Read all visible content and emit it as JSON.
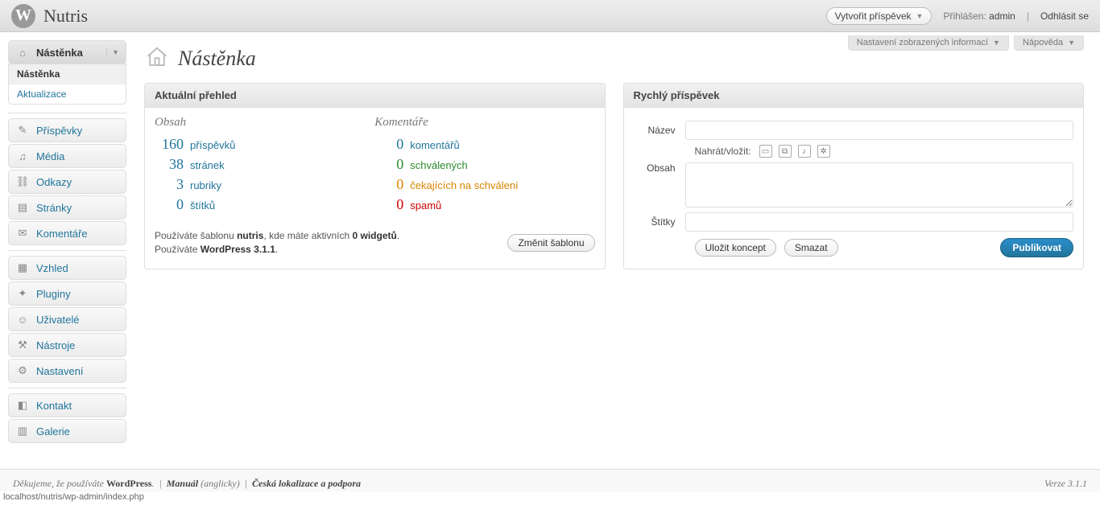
{
  "header": {
    "site_title": "Nutris",
    "logo_letter": "W",
    "new_post": "Vytvořit příspěvek",
    "howdy_prefix": "Přihlášen:",
    "user": "admin",
    "logout": "Odhlásit se"
  },
  "screen_meta": {
    "options": "Nastavení zobrazených informací",
    "help": "Nápověda"
  },
  "page_title": "Nástěnka",
  "sidebar": {
    "dashboard": {
      "label": "Nástěnka",
      "sub_dashboard": "Nástěnka",
      "sub_updates": "Aktualizace"
    },
    "posts": {
      "label": "Příspěvky"
    },
    "media": {
      "label": "Média"
    },
    "links": {
      "label": "Odkazy"
    },
    "pages": {
      "label": "Stránky"
    },
    "comments": {
      "label": "Komentáře"
    },
    "appearance": {
      "label": "Vzhled"
    },
    "plugins": {
      "label": "Pluginy"
    },
    "users": {
      "label": "Uživatelé"
    },
    "tools": {
      "label": "Nástroje"
    },
    "settings": {
      "label": "Nastavení"
    },
    "kontakt": {
      "label": "Kontakt"
    },
    "galerie": {
      "label": "Galerie"
    }
  },
  "right_now": {
    "title": "Aktuální přehled",
    "content_head": "Obsah",
    "discussion_head": "Komentáře",
    "content": {
      "posts": {
        "num": "160",
        "label": "příspěvků"
      },
      "pages": {
        "num": "38",
        "label": "stránek"
      },
      "categories": {
        "num": "3",
        "label": "rubriky"
      },
      "tags": {
        "num": "0",
        "label": "štítků"
      }
    },
    "discussion": {
      "total": {
        "num": "0",
        "label": "komentářů"
      },
      "approved": {
        "num": "0",
        "label": "schválených"
      },
      "pending": {
        "num": "0",
        "label": "čekajících na schválení"
      },
      "spam": {
        "num": "0",
        "label": "spamů"
      }
    },
    "theme_line_prefix": "Používáte šablonu ",
    "theme_name": "nutris",
    "theme_line_middle": ", kde máte aktivních ",
    "widgets": "0 widgetů",
    "theme_line_suffix": ".",
    "change_theme": "Změnit šablonu",
    "wp_line_prefix": "Používáte ",
    "wp_version": "WordPress 3.1.1",
    "wp_line_suffix": "."
  },
  "quickpress": {
    "title": "Rychlý příspěvek",
    "label_name": "Název",
    "label_media": "Nahrát/vložit:",
    "label_content": "Obsah",
    "label_tags": "Štítky",
    "save_draft": "Uložit koncept",
    "reset": "Smazat",
    "publish": "Publikovat"
  },
  "footer": {
    "thanks_prefix": "Děkujeme, že používáte ",
    "wordpress": "WordPress",
    "thanks_suffix": ".",
    "manual": "Manuál",
    "manual_lang": " (anglicky)",
    "local": "Česká lokalizace a podpora",
    "version": "Verze 3.1.1",
    "statusbar": "localhost/nutris/wp-admin/index.php"
  }
}
